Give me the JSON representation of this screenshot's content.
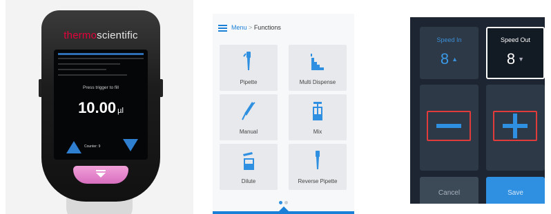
{
  "device": {
    "brand_part1": "thermo",
    "brand_part2": "scientific",
    "prompt": "Press trigger to fill",
    "volume": "10.00",
    "unit": "µl",
    "counter": "Counter: 9"
  },
  "menu": {
    "breadcrumb_root": "Menu",
    "breadcrumb_sep": ">",
    "breadcrumb_current": "Functions",
    "tiles": [
      {
        "label": "Pipette",
        "icon": "pipette-icon"
      },
      {
        "label": "Multi Dispense",
        "icon": "multi-dispense-icon"
      },
      {
        "label": "Manual",
        "icon": "manual-icon"
      },
      {
        "label": "Mix",
        "icon": "mix-icon"
      },
      {
        "label": "Dilute",
        "icon": "dilute-icon"
      },
      {
        "label": "Reverse Pipette",
        "icon": "reverse-pipette-icon"
      }
    ]
  },
  "speed": {
    "in_label": "Speed In",
    "in_value": "8",
    "out_label": "Speed Out",
    "out_value": "8",
    "cancel": "Cancel",
    "save": "Save"
  },
  "colors": {
    "accent_blue": "#2f8fe0",
    "brand_red": "#e4003a",
    "stepper_border": "#e13b3b",
    "trigger_pink": "#e88bcd"
  }
}
